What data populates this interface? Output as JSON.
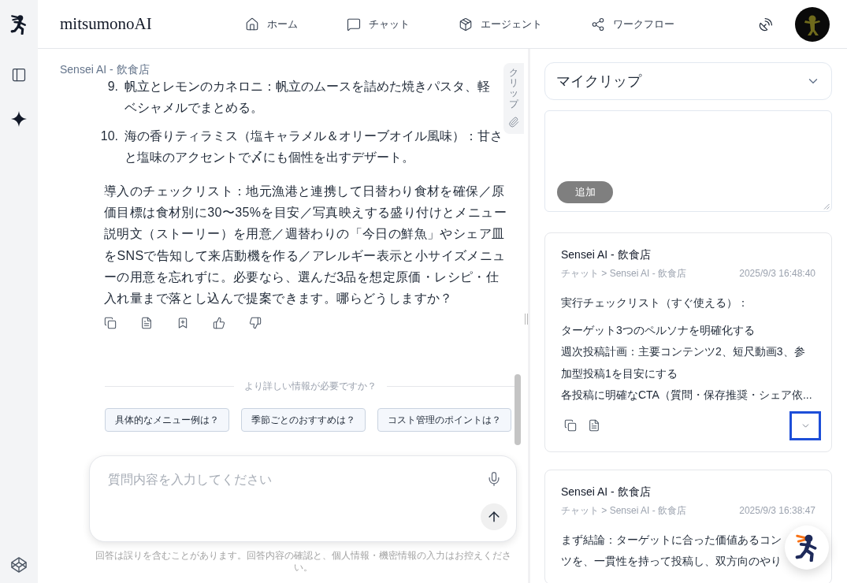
{
  "header": {
    "brand": "mitsumonoAI",
    "nav": [
      {
        "kind": "home",
        "label": "ホーム"
      },
      {
        "kind": "chat",
        "label": "チャット"
      },
      {
        "kind": "agent",
        "label": "エージェント"
      },
      {
        "kind": "workflow",
        "label": "ワークフロー"
      }
    ]
  },
  "chat": {
    "assistant": "Sensei AI - 飲食店",
    "list": [
      {
        "number": "9.",
        "lines": [
          "帆立とレモンのカネロニ：帆立のムースを詰めた焼きパスタ、軽",
          "ベシャメルでまとめる。"
        ]
      },
      {
        "number": "10.",
        "lines": [
          "海の香りティラミス（塩キャラメル＆オリーブオイル風味）：甘さ",
          "と塩味のアクセントで〆にも個性を出すデザート。"
        ]
      }
    ],
    "paragraph": "導入のチェックリスト：地元漁港と連携して日替わり食材を確保／原価目標は食材別に30〜35%を目安／写真映えする盛り付けとメニュー説明文（ストーリー）を用意／週替わりの「今日の鮮魚」やシェア皿をSNSで告知して来店動機を作る／アレルギー表示と小サイズメニューの用意を忘れずに。必要なら、選んだ3品を想定原価・レシピ・仕入れ量まで落とし込んで提案できます。哪らどうしますか？",
    "follow_up": {
      "prompt": "より詳しい情報が必要ですか？",
      "suggestions": [
        "具体的なメニュー例は？",
        "季節ごとのおすすめは？",
        "コスト管理のポイントは？"
      ]
    },
    "input": {
      "placeholder": "質問内容を入力してください"
    },
    "disclaimer": "回答は誤りを含むことがあります。回答内容の確認と、個人情報・機密情報の入力はお控えください。"
  },
  "clip_tab": {
    "label": "クリップ"
  },
  "clip_panel": {
    "dropdown": {
      "value": "マイクリップ"
    },
    "note": {
      "button": "追加"
    },
    "cards": [
      {
        "title": "Sensei AI - 飲食店",
        "breadcrumb": "チャット > Sensei AI - 飲食店",
        "timestamp": "2025/9/3 16:48:40",
        "paragraphs": [
          {
            "lines": [
              "実行チェックリスト（すぐ使える）："
            ]
          },
          {
            "lines": [
              "ターゲット3つのペルソナを明確化する",
              "週次投稿計画：主要コンテンツ2、短尺動画3、参",
              "加型投稿1を目安にする",
              "各投稿に明確なCTA（質問・保存推奨・シェア依..."
            ]
          }
        ],
        "expand_button": {
          "focused": true
        }
      },
      {
        "title": "Sensei AI - 飲食店",
        "breadcrumb": "チャット > Sensei AI - 飲食店",
        "timestamp": "2025/9/3 16:38:47",
        "paragraphs": [
          {
            "lines": [
              "まず結論：ターゲットに合った価値あるコン",
              "ツを、一貫性を持って投稿し、双方向のやり"
            ]
          }
        ]
      }
    ]
  }
}
